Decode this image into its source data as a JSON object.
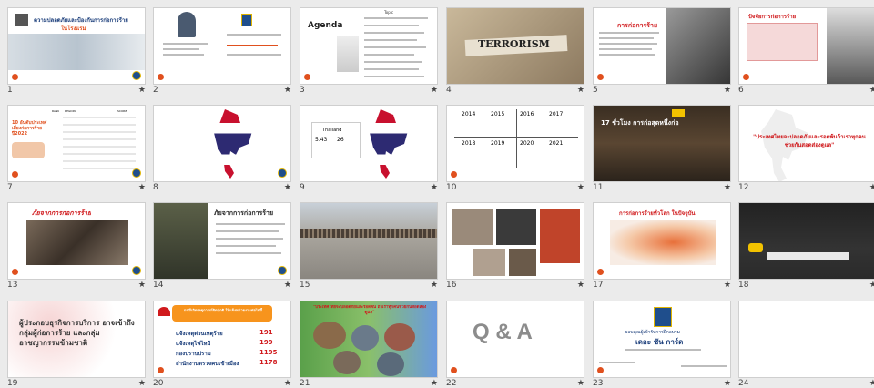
{
  "slides": [
    {
      "num": "1",
      "title": "ความปลอดภัยและป้องกันการก่อการร้าย",
      "subtitle": "ในโรงแรม"
    },
    {
      "num": "2"
    },
    {
      "num": "3",
      "title": "Agenda",
      "header": "Topic"
    },
    {
      "num": "4",
      "title": "TERRORISM"
    },
    {
      "num": "5",
      "title": "การก่อการร้าย"
    },
    {
      "num": "6",
      "title": "ปัจจัยการก่อการร้าย"
    },
    {
      "num": "7",
      "title": "10 อันดับประเทศ เสี่ยงก่อการร้าย ปี2022",
      "rank": "RANK",
      "region": "REGION",
      "score": "SCORE"
    },
    {
      "num": "8"
    },
    {
      "num": "9",
      "country": "Thailand",
      "score": "5.43",
      "rank": "26"
    },
    {
      "num": "10",
      "years": [
        "2014",
        "2015",
        "2016",
        "2017",
        "2018",
        "2019",
        "2020",
        "2021"
      ]
    },
    {
      "num": "11",
      "title": "17 ชั่วโมง การก่อสุดหนึ่งก่อ"
    },
    {
      "num": "12",
      "title": "\"ประเทศไทยจะปลอดภัยและรอดพ้นถ้าเราทุกคนช่วยกันสอดส่องดูแล\""
    },
    {
      "num": "13",
      "title": "ภัยจากการก่อการร้าย"
    },
    {
      "num": "14",
      "title": "ภัยจากการก่อการร้าย"
    },
    {
      "num": "15"
    },
    {
      "num": "16"
    },
    {
      "num": "17",
      "title": "การก่อการร้ายทั่วโลก ในปัจจุบัน"
    },
    {
      "num": "18"
    },
    {
      "num": "19",
      "title": "ผู้ประกอบธุรกิจการบริการ อาจเข้าถึงกลุ่มผู้ก่อการร้าย และกลุ่มอาชญากรรมข้ามชาติ"
    },
    {
      "num": "20",
      "header": "กรณีเกิดเหตุการณ์ผิดปกติ ให้แจ้งหน่วยงานต่อไปนี้",
      "lines": [
        "แจ้งเหตุด่วนเหตุร้าย",
        "แจ้งเหตุไฟไหม้",
        "กองปราบปราม",
        "สำนักงานตรวจคนเข้าเมือง"
      ],
      "phones": [
        "191",
        "199",
        "1195",
        "1178"
      ]
    },
    {
      "num": "21",
      "title": "\"ประเทศไทยจะปลอดภัยและรอดพ้น ถ้าเราทุกคนช่วยกันสอดส่องดูแล\""
    },
    {
      "num": "22",
      "title": "Q & A"
    },
    {
      "num": "23",
      "line1": "ขอบคุณผู้เข้ารับการฝึกอบรม",
      "line2": "เดอะ ซัน การ์ด"
    },
    {
      "num": "24"
    }
  ],
  "star": "★"
}
